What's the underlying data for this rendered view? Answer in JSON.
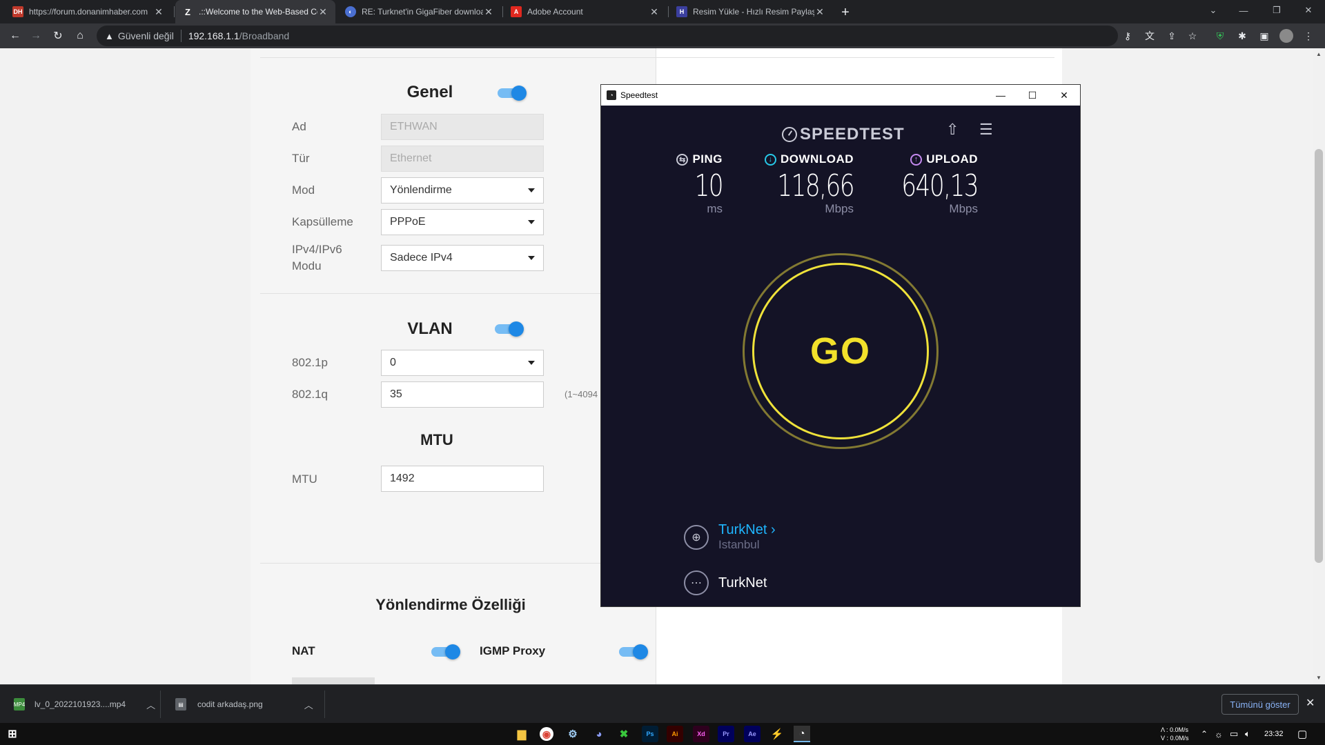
{
  "browser": {
    "tabs": [
      {
        "label": "https://forum.donanimhaber.com",
        "favicon": "DH",
        "favicon_color": "#c0392b",
        "active": false
      },
      {
        "label": ".::Welcome to the Web-Based Co",
        "favicon": "Z",
        "favicon_color": "#202124",
        "active": true
      },
      {
        "label": "RE: Turknet'in GigaFiber downloa",
        "favicon": "globe",
        "favicon_color": "#4a6fd1",
        "active": false
      },
      {
        "label": "Adobe Account",
        "favicon": "A",
        "favicon_color": "#e0281f",
        "active": false
      },
      {
        "label": "Resim Yükle - Hızlı Resim Paylaş",
        "favicon": "H",
        "favicon_color": "#3b3f9e",
        "active": false
      }
    ],
    "omnibox": {
      "security_label": "Güvenli değil",
      "host": "192.168.1.1",
      "path": "/Broadband"
    }
  },
  "router": {
    "genel": {
      "title": "Genel",
      "enabled": true,
      "fields": {
        "ad": {
          "label": "Ad",
          "value": "ETHWAN"
        },
        "tur": {
          "label": "Tür",
          "value": "Ethernet"
        },
        "mod": {
          "label": "Mod",
          "value": "Yönlendirme"
        },
        "kapsulleme": {
          "label": "Kapsülleme",
          "value": "PPPoE"
        },
        "ipmode": {
          "label_line1": "IPv4/IPv6",
          "label_line2": "Modu",
          "value": "Sadece IPv4"
        }
      }
    },
    "vlan": {
      "title": "VLAN",
      "enabled": true,
      "p8021": {
        "label": "802.1p",
        "value": "0"
      },
      "q8021": {
        "label": "802.1q",
        "value": "35",
        "hint": "(1~4094"
      }
    },
    "mtu": {
      "title": "MTU",
      "label": "MTU",
      "value": "1492"
    },
    "routing": {
      "title": "Yönlendirme Özelliği",
      "nat": {
        "label": "NAT",
        "enabled": true
      },
      "igmp": {
        "label": "IGMP Proxy",
        "enabled": true
      }
    }
  },
  "speedtest": {
    "window_title": "Speedtest",
    "logo": "SPEEDTEST",
    "ping": {
      "label": "PING",
      "value": "10",
      "unit": "ms"
    },
    "download": {
      "label": "DOWNLOAD",
      "value": "118,66",
      "unit": "Mbps"
    },
    "upload": {
      "label": "UPLOAD",
      "value": "640,13",
      "unit": "Mbps"
    },
    "go_label": "GO",
    "server": {
      "name": "TurkNet",
      "location": "Istanbul"
    },
    "provider": {
      "name": "TurkNet"
    },
    "colors": {
      "ping": "#c9cad6",
      "download": "#27c9e8",
      "upload": "#c58af0",
      "go": "#f2e12b"
    }
  },
  "downloads": {
    "items": [
      {
        "name": "lv_0_2022101923....mp4",
        "type": "mp4"
      },
      {
        "name": "codit arkadaş.png",
        "type": "png"
      }
    ],
    "show_all_label": "Tümünü göster"
  },
  "taskbar": {
    "net_up": "0.0M/s",
    "net_down": "0.0M/s",
    "net_up_label": "Λ :",
    "net_down_label": "V :",
    "time": "23:32"
  }
}
